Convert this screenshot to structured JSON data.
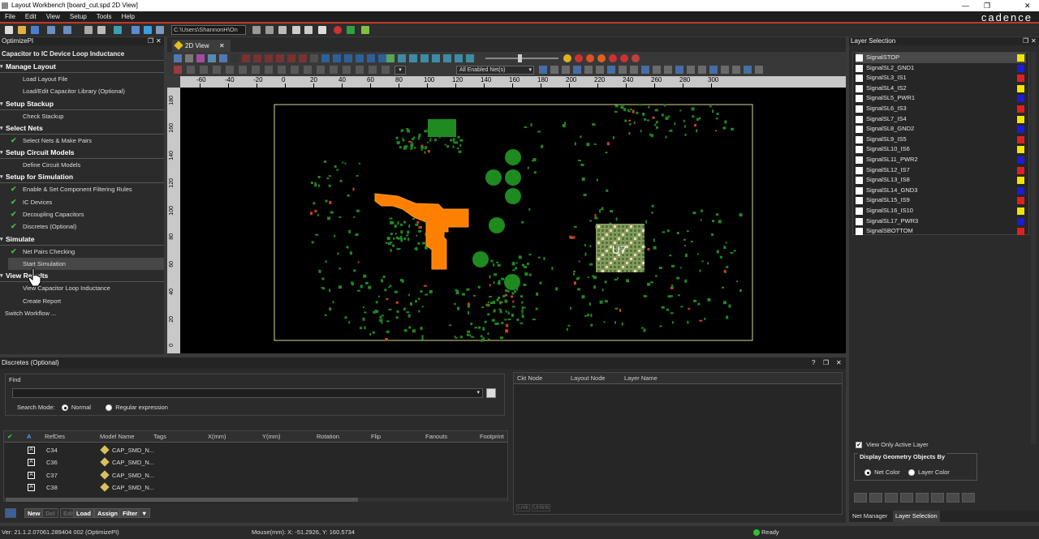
{
  "window": {
    "title": "Layout Workbench [board_cut.spd 2D View]",
    "brand": "cadence"
  },
  "menu": [
    "File",
    "Edit",
    "View",
    "Setup",
    "Tools",
    "Help"
  ],
  "toolbar": {
    "path": "C:\\Users\\ShannonH\\On"
  },
  "left_panel": {
    "header": "OptimizePI",
    "workflow_title": "Capacitor to IC Device Loop Inductance",
    "sections": [
      {
        "title": "Manage Layout",
        "items": [
          {
            "label": "Load Layout File",
            "checked": false
          },
          {
            "label": "Load/Edit Capacitor Library (Optional)",
            "checked": false
          }
        ]
      },
      {
        "title": "Setup Stackup",
        "items": [
          {
            "label": "Check Stackup",
            "checked": false
          }
        ]
      },
      {
        "title": "Select Nets",
        "items": [
          {
            "label": "Select Nets & Make Pairs",
            "checked": true
          }
        ]
      },
      {
        "title": "Setup Circuit Models",
        "items": [
          {
            "label": "Define Circuit Models",
            "checked": false
          }
        ]
      },
      {
        "title": "Setup for Simulation",
        "items": [
          {
            "label": "Enable & Set Component Filtering Rules",
            "checked": true
          },
          {
            "label": "IC Devices",
            "checked": true
          },
          {
            "label": "Decoupling Capacitors",
            "checked": true
          },
          {
            "label": "Discretes (Optional)",
            "checked": true
          }
        ]
      },
      {
        "title": "Simulate",
        "items": [
          {
            "label": "Net Pairs Checking",
            "checked": true
          },
          {
            "label": "Start Simulation",
            "checked": false
          }
        ]
      },
      {
        "title": "View Results",
        "items": [
          {
            "label": "View Capacitor Loop Inductance",
            "checked": false
          },
          {
            "label": "Create Report",
            "checked": false
          }
        ]
      }
    ],
    "switch_label": "Switch Workflow ..."
  },
  "view": {
    "tab_label": "2D View",
    "net_filter": "All Enabled Net(s)",
    "ruler_top": [
      "-60",
      "-40",
      "-20",
      "0",
      "20",
      "40",
      "60",
      "80",
      "100",
      "120",
      "140",
      "160",
      "180",
      "200",
      "220",
      "240",
      "260",
      "280",
      "300"
    ],
    "ruler_left": [
      "180",
      "160",
      "140",
      "120",
      "100",
      "80",
      "60",
      "40",
      "20",
      "0"
    ],
    "ic_label": "U7"
  },
  "right_panel": {
    "header": "Layer Selection",
    "layers": [
      {
        "name": "SignalSTOP",
        "color": "#f0e600"
      },
      {
        "name": "SignalSL2_GND1",
        "color": "#1c1cd6"
      },
      {
        "name": "SignalSL3_IS1",
        "color": "#e02020"
      },
      {
        "name": "SignalSL4_IS2",
        "color": "#f0e600"
      },
      {
        "name": "SignalSL5_PWR1",
        "color": "#1c1cd6"
      },
      {
        "name": "SignalSL6_IS3",
        "color": "#e02020"
      },
      {
        "name": "SignalSL7_IS4",
        "color": "#f0e600"
      },
      {
        "name": "SignalSL8_GND2",
        "color": "#1c1cd6"
      },
      {
        "name": "SignalSL9_IS5",
        "color": "#e02020"
      },
      {
        "name": "SignalSL10_IS6",
        "color": "#f0e600"
      },
      {
        "name": "SignalSL11_PWR2",
        "color": "#1c1cd6"
      },
      {
        "name": "SignalSL12_IS7",
        "color": "#e02020"
      },
      {
        "name": "SignalSL13_IS8",
        "color": "#f0e600"
      },
      {
        "name": "SignalSL14_GND3",
        "color": "#1c1cd6"
      },
      {
        "name": "SignalSL15_IS9",
        "color": "#e02020"
      },
      {
        "name": "SignalSL16_IS10",
        "color": "#f0e600"
      },
      {
        "name": "SignalSL17_PWR3",
        "color": "#1c1cd6"
      },
      {
        "name": "SignalSBOTTOM",
        "color": "#e02020"
      }
    ],
    "view_only_active": "View Only Active Layer",
    "display_group_title": "Display Geometry Objects By",
    "opt_net_color": "Net Color",
    "opt_layer_color": "Layer Color",
    "tabs": [
      "Net Manager",
      "Layer Selection"
    ]
  },
  "bottom_panel": {
    "title": "Discretes (Optional)",
    "find_label": "Find",
    "search_mode_label": "Search Mode:",
    "mode_normal": "Normal",
    "mode_regex": "Regular expression",
    "columns": [
      "RefDes",
      "Model Name",
      "Tags",
      "X(mm)",
      "Y(mm)",
      "Rotation",
      "Flip",
      "Fanouts",
      "Footprint"
    ],
    "rows": [
      {
        "refdes": "C34",
        "model": "CAP_SMD_N..."
      },
      {
        "refdes": "C36",
        "model": "CAP_SMD_N..."
      },
      {
        "refdes": "C37",
        "model": "CAP_SMD_N..."
      },
      {
        "refdes": "C38",
        "model": "CAP_SMD_N..."
      }
    ],
    "buttons": [
      "New",
      "Del",
      "Edit",
      "Load",
      "Assign",
      "Filter"
    ],
    "node_columns": [
      "Ckt Node",
      "Layout Node",
      "Layer Name"
    ],
    "link_buttons": [
      "Link",
      "Unlink"
    ]
  },
  "status": {
    "version": "Ver: 21.1.2.07061.289404 002 (OptimizePI)",
    "mouse": "Mouse(mm): X: -51.2926, Y: 160.5734",
    "state": "Ready"
  }
}
